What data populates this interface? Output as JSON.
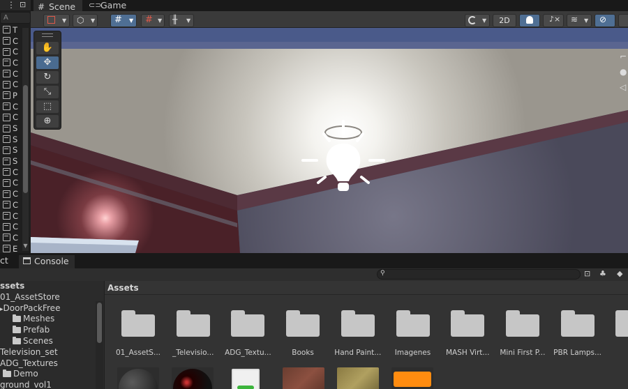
{
  "hierarchy": {
    "search_placeholder": "A",
    "items": [
      "T",
      "C",
      "C",
      "C",
      "C",
      "C",
      "P",
      "C",
      "C",
      "S",
      "S",
      "S",
      "S",
      "C",
      "C",
      "C",
      "C",
      "C",
      "C",
      "C",
      "E"
    ]
  },
  "scene_tabs": {
    "scene": "Scene",
    "game": "Game"
  },
  "toolbar": {
    "mode_2d": "2D"
  },
  "lower_tabs": {
    "project": "ct",
    "console": "Console"
  },
  "project": {
    "tree_header": "ssets",
    "tree": [
      {
        "label": "01_AssetStore",
        "folder": false
      },
      {
        "label": "DoorPackFree",
        "folder": false
      },
      {
        "label": "Meshes",
        "folder": true
      },
      {
        "label": "Prefab",
        "folder": true
      },
      {
        "label": "Scenes",
        "folder": true
      },
      {
        "label": "Television_set",
        "folder": false
      },
      {
        "label": "ADG_Textures",
        "folder": false
      },
      {
        "label": "Demo",
        "folder": true
      },
      {
        "label": "ground_vol1",
        "folder": false
      }
    ],
    "grid_header": "Assets",
    "folders": [
      "01_AssetS...",
      "_Televisio...",
      "ADG_Textu...",
      "Books",
      "Hand Paint...",
      "Imagenes",
      "MASH Virt...",
      "Mini First P...",
      "PBR Lamps...",
      "Sc"
    ]
  },
  "colors": {
    "accent": "#4f6f94",
    "panel": "#383838",
    "selected_tool": "#4a6b90"
  },
  "icons": [
    "hand-icon",
    "move-icon",
    "rotate-icon",
    "scale-icon",
    "rect-icon",
    "transform-icon",
    "light-bulb-icon",
    "folder-icon",
    "search-icon"
  ]
}
